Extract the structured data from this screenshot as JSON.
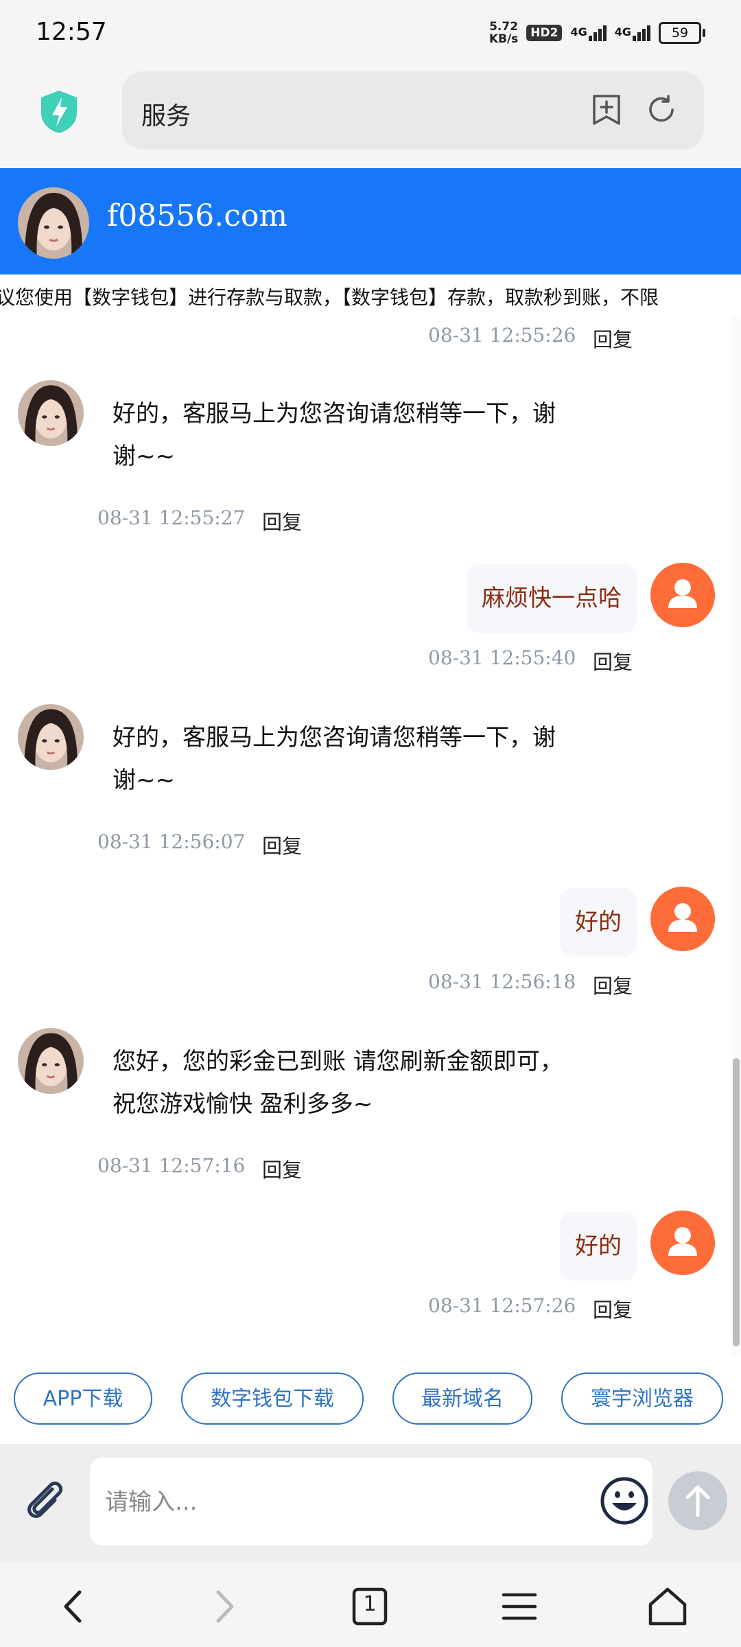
{
  "status_bar": {
    "time": "12:57",
    "speed_value": "5.72",
    "speed_unit": "KB/s",
    "hd_badge": "HD2",
    "network_1": "4G",
    "network_2": "4G",
    "battery": "59"
  },
  "browser": {
    "url_text": "服务",
    "shield_icon": "shield-bolt-icon",
    "bookmark_icon": "add-bookmark-icon",
    "refresh_icon": "refresh-icon"
  },
  "header": {
    "title": "f08556.com"
  },
  "marquee": {
    "text": "议您使用【数字钱包】进行存款与取款，【数字钱包】存款，取款秒到账，不限"
  },
  "messages": [
    {
      "side": "user",
      "text": "",
      "time": "08-31 12:55:26",
      "reply": "回复"
    },
    {
      "side": "agent",
      "text_line1": "好的，客服马上为您咨询请您稍等一下，谢",
      "text_line2": "谢~~",
      "time": "08-31 12:55:27",
      "reply": "回复"
    },
    {
      "side": "user",
      "text": "麻烦快一点哈",
      "time": "08-31 12:55:40",
      "reply": "回复"
    },
    {
      "side": "agent",
      "text_line1": "好的，客服马上为您咨询请您稍等一下，谢",
      "text_line2": "谢~~",
      "time": "08-31 12:56:07",
      "reply": "回复"
    },
    {
      "side": "user",
      "text": "好的",
      "time": "08-31 12:56:18",
      "reply": "回复"
    },
    {
      "side": "agent",
      "text_line1": "您好，您的彩金已到账 请您刷新金额即可，",
      "text_line2": "祝您游戏愉快 盈利多多~",
      "time": "08-31 12:57:16",
      "reply": "回复"
    },
    {
      "side": "user",
      "text": "好的",
      "time": "08-31 12:57:26",
      "reply": "回复"
    }
  ],
  "quick_links": [
    "APP下载",
    "数字钱包下载",
    "最新域名",
    "寰宇浏览器"
  ],
  "input": {
    "placeholder": "请输入..."
  },
  "bottom_nav": {
    "tab_count": "1"
  },
  "colors": {
    "header_blue": "#1877f7",
    "user_avatar": "#fe6c3a",
    "user_text": "#8b2e14",
    "link_blue": "#2f73c4"
  }
}
